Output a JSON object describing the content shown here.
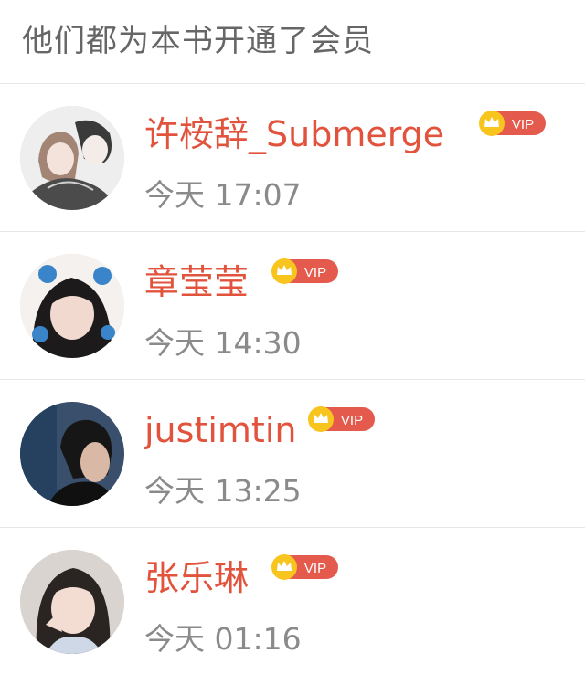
{
  "header": {
    "title": "他们都为本书开通了会员"
  },
  "vip_badge_text": "VIP",
  "colors": {
    "name": "#e2533d",
    "badge": "#e45a4c",
    "crown_bg": "#f7c51e",
    "time": "#8a8a8a",
    "divider": "#e6e6e6"
  },
  "members": [
    {
      "name": "许桉辞_Submerge",
      "time": "今天 17:07"
    },
    {
      "name": "章莹莹",
      "time": "今天 14:30"
    },
    {
      "name": "justimtin",
      "time": "今天 13:25"
    },
    {
      "name": "张乐琳",
      "time": "今天 01:16"
    }
  ]
}
